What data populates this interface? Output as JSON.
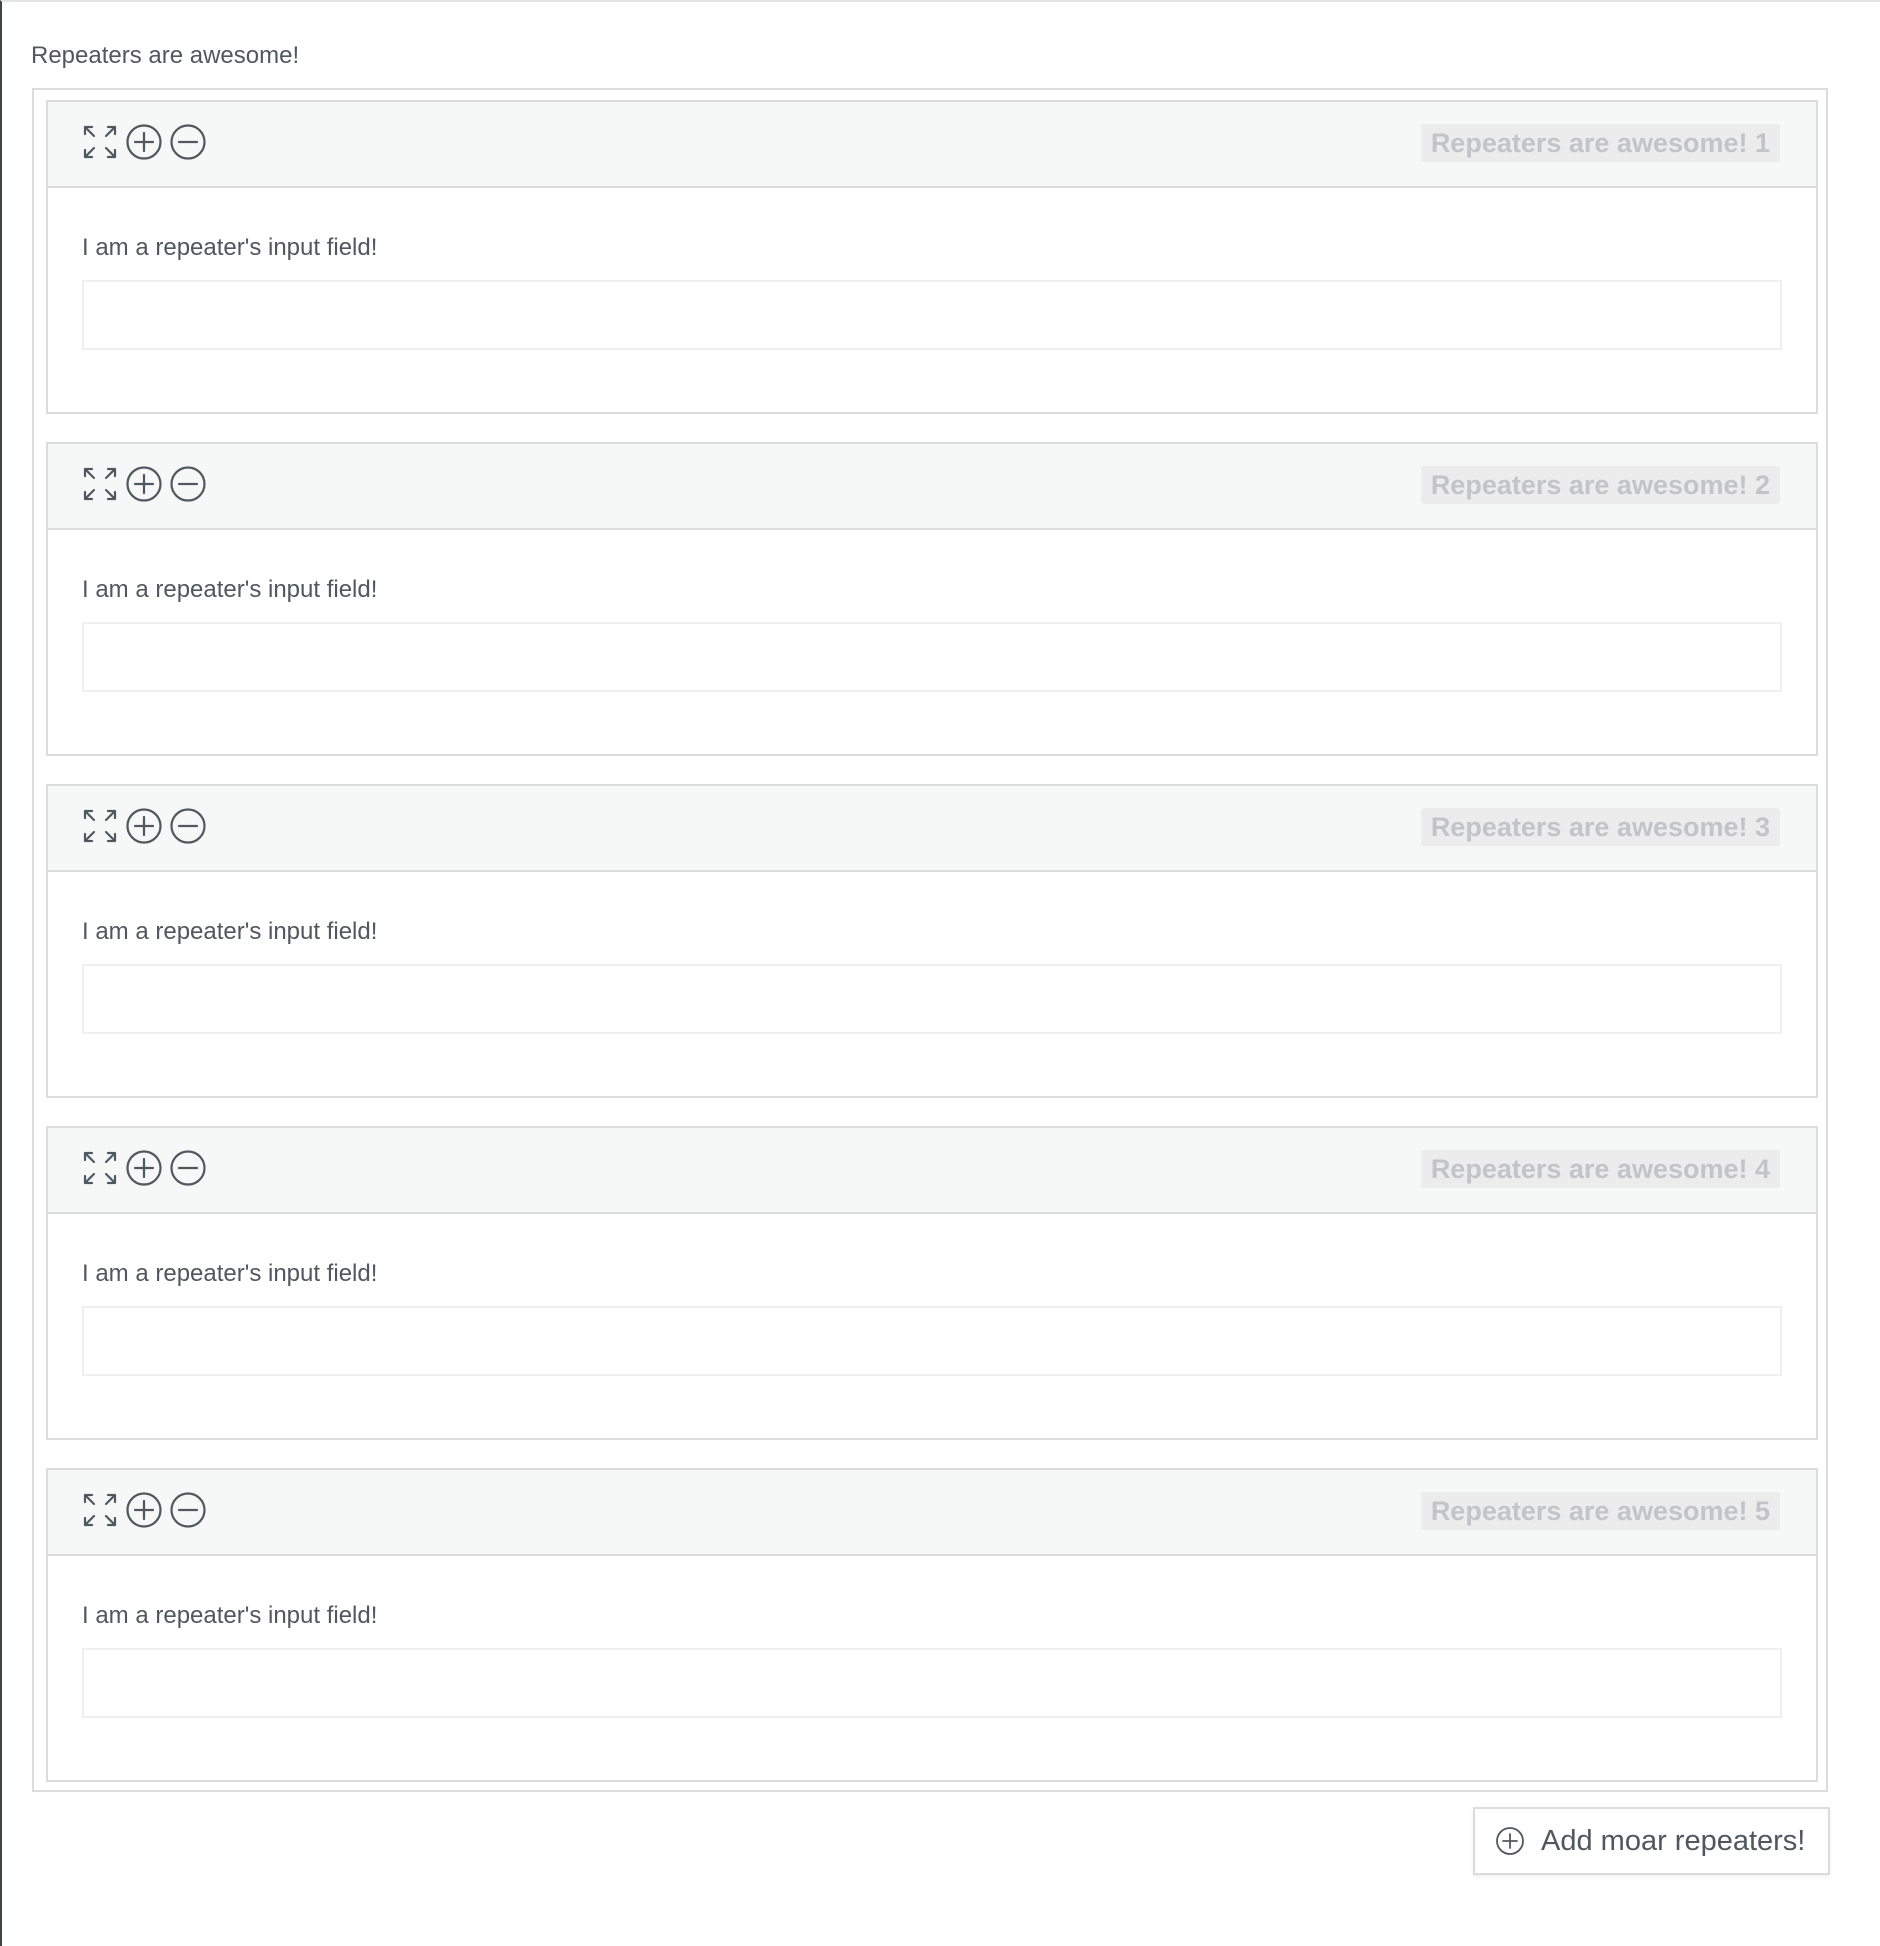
{
  "group": {
    "label": "Repeaters are awesome!"
  },
  "rows": [
    {
      "title": "Repeaters are awesome! 1",
      "field_label": "I am a repeater's input field!",
      "field_value": ""
    },
    {
      "title": "Repeaters are awesome! 2",
      "field_label": "I am a repeater's input field!",
      "field_value": ""
    },
    {
      "title": "Repeaters are awesome! 3",
      "field_label": "I am a repeater's input field!",
      "field_value": ""
    },
    {
      "title": "Repeaters are awesome! 4",
      "field_label": "I am a repeater's input field!",
      "field_value": ""
    },
    {
      "title": "Repeaters are awesome! 5",
      "field_label": "I am a repeater's input field!",
      "field_value": ""
    }
  ],
  "row_tools": {
    "expand_icon": "expand-arrows-icon",
    "add_icon": "plus-circle-icon",
    "remove_icon": "minus-circle-icon"
  },
  "add_button": {
    "label": "Add moar repeaters!",
    "icon": "plus-circle-icon"
  },
  "colors": {
    "text": "#50575e",
    "border": "#dcdcde",
    "header_bg": "#f6f7f7",
    "title_badge_bg": "#ececec",
    "title_badge_text": "#c3c4c7"
  }
}
